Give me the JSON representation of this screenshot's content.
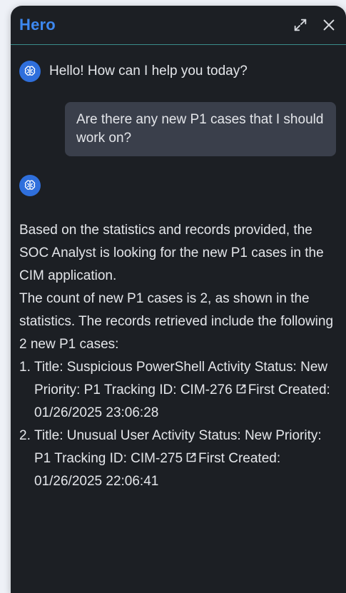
{
  "header": {
    "title": "Hero",
    "icons": [
      "expand-icon",
      "close-icon"
    ]
  },
  "messages": {
    "greeting": "Hello! How can I help you today?",
    "user_question": "Are there any new P1 cases that I should work on?",
    "answer_intro": "Based on the statistics and records provided, the SOC Analyst is looking for the new P1 cases in the CIM application.",
    "answer_count": "The count of new P1 cases is 2, as shown in the statistics. The records retrieved include the following 2 new P1 cases:",
    "cases": [
      {
        "num": "1.",
        "before_link": "Title: Suspicious PowerShell Activity Status: New Priority: P1 Tracking ID: CIM-276",
        "after_link": "First Created: 01/26/2025 23:06:28"
      },
      {
        "num": "2.",
        "before_link": "Title: Unusual User Activity Status: New Priority: P1 Tracking ID: CIM-275",
        "after_link": "First Created: 01/26/2025 22:06:41"
      }
    ]
  },
  "colors": {
    "panel_bg": "#1c1f24",
    "title": "#3d88f0",
    "divider": "#3a8c8a",
    "user_bubble": "#3a3f4b",
    "avatar": "#2f6fdc"
  }
}
